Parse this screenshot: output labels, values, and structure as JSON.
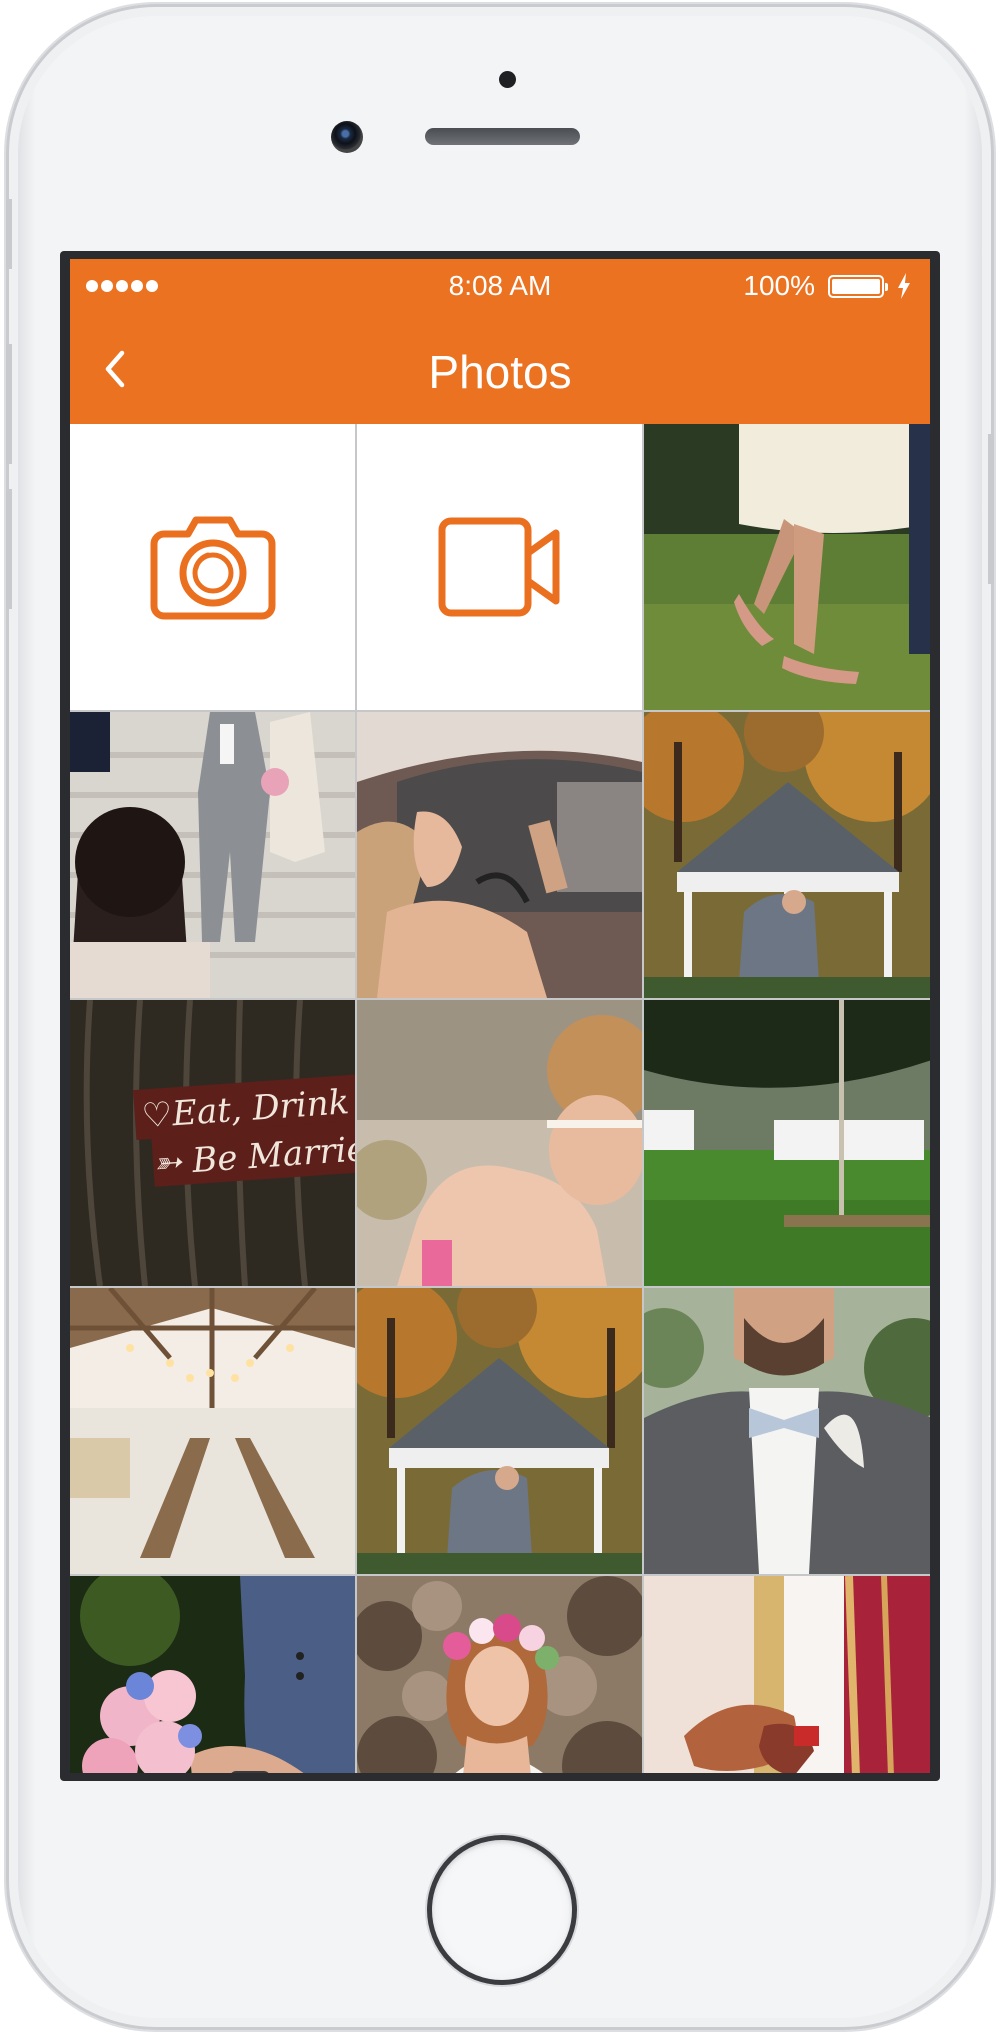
{
  "status_bar": {
    "time": "8:08 AM",
    "battery": "100%",
    "signal_dots": 5
  },
  "nav": {
    "title": "Photos",
    "back_icon": "chevron-left-icon"
  },
  "colors": {
    "accent": "#eb7221",
    "accent_icon": "#ea7020"
  },
  "actions": [
    {
      "name": "take-photo-button",
      "icon": "camera-icon"
    },
    {
      "name": "record-video-button",
      "icon": "video-camera-icon"
    }
  ],
  "photos": [
    {
      "name": "photo-dress-heels"
    },
    {
      "name": "photo-couple-stairs"
    },
    {
      "name": "photo-car-makeup"
    },
    {
      "name": "photo-gazebo-kiss"
    },
    {
      "name": "photo-eat-drink-sign",
      "sign_text": [
        "♡Eat, Drink a",
        "➳ Be Married"
      ]
    },
    {
      "name": "photo-bride-updo"
    },
    {
      "name": "photo-lawn-swing"
    },
    {
      "name": "photo-barn-reception"
    },
    {
      "name": "photo-gazebo-kiss-2"
    },
    {
      "name": "photo-groom-bowtie"
    },
    {
      "name": "photo-bouquet-watch"
    },
    {
      "name": "photo-bride-flower-crown"
    },
    {
      "name": "photo-henna-hands"
    }
  ]
}
